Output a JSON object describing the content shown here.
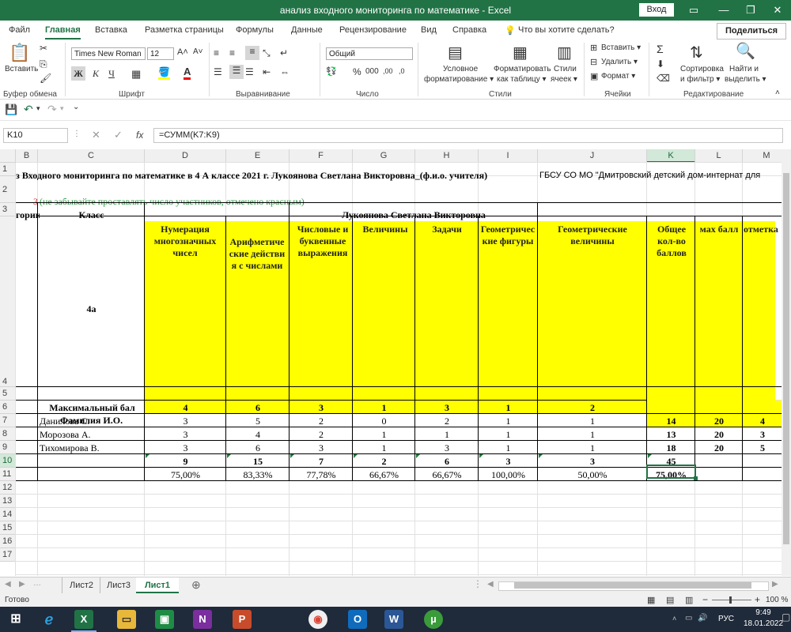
{
  "window": {
    "title": "анализ входного мониторинга по математике - Excel",
    "login": "Вход"
  },
  "tabs": [
    "Файл",
    "Главная",
    "Вставка",
    "Разметка страницы",
    "Формулы",
    "Данные",
    "Рецензирование",
    "Вид",
    "Справка"
  ],
  "tell_me": "Что вы хотите сделать?",
  "share": "Поделиться",
  "ribbon": {
    "paste": "Вставить",
    "font_name": "Times New Roman",
    "font_size": "12",
    "number_format": "Общий",
    "bold": "Ж",
    "italic": "К",
    "underline": "Ч",
    "cond_format": [
      "Условное",
      "форматирование ▾"
    ],
    "format_table": [
      "Форматировать",
      "как таблицу ▾"
    ],
    "cell_styles": [
      "Стили",
      "ячеек ▾"
    ],
    "insert": "Вставить ▾",
    "delete": "Удалить ▾",
    "format": "Формат ▾",
    "sort": [
      "Сортировка",
      "и фильтр ▾"
    ],
    "find": [
      "Найти и",
      "выделить ▾"
    ],
    "groups": [
      "Буфер обмена",
      "Шрифт",
      "Выравнивание",
      "Число",
      "Стили",
      "Ячейки",
      "Редактирование"
    ]
  },
  "formula_bar": {
    "name_box": "K10",
    "formula": "=СУММ(K7:K9)",
    "fx": "fx"
  },
  "columns": [
    "B",
    "C",
    "D",
    "E",
    "F",
    "G",
    "H",
    "I",
    "J",
    "K",
    "L",
    "M"
  ],
  "rows": [
    "1",
    "2",
    "3",
    "4",
    "5",
    "6",
    "7",
    "8",
    "9",
    "10",
    "11",
    "12",
    "13",
    "14",
    "15",
    "16",
    "17"
  ],
  "sheet": {
    "title": "з Входного мониторинга по математике в 4 А классе 2021 г. Лукоянова Светлана Викторовна_(ф.и.о. учителя)",
    "school": "ГБСУ СО МО \"Дмитровский детский дом-интернат для",
    "count": "3",
    "reminder": "(не забывайте проставлять число участников, отмечено красным)",
    "category": "гории",
    "class_label": "Класс",
    "teacher": "Лукоянова Светлана Викторовна",
    "class_value": "4а",
    "headers": [
      "Нумерация многозначных чисел",
      "Арифметические действия с числами",
      "Числовые и буквенные выражения",
      "Величины",
      "Задачи",
      "Геометрические фигуры",
      "Геометрические величины",
      "Общее кол-во баллов",
      "мах балл",
      "отметка"
    ],
    "max_label": "Максимальный бал",
    "max_values": [
      "4",
      "6",
      "3",
      "1",
      "3",
      "1",
      "2"
    ],
    "fio_label": "Фамилия И.О.",
    "students": [
      {
        "name": "Данилова С.",
        "scores": [
          "3",
          "5",
          "2",
          "0",
          "2",
          "1",
          "1"
        ],
        "total": "14",
        "max": "20",
        "mark": "4"
      },
      {
        "name": "Морозова А.",
        "scores": [
          "3",
          "4",
          "2",
          "1",
          "1",
          "1",
          "1"
        ],
        "total": "13",
        "max": "20",
        "mark": "3"
      },
      {
        "name": "Тихомирова В.",
        "scores": [
          "3",
          "6",
          "3",
          "1",
          "3",
          "1",
          "1"
        ],
        "total": "18",
        "max": "20",
        "mark": "5"
      }
    ],
    "sums": [
      "9",
      "15",
      "7",
      "2",
      "6",
      "3",
      "3",
      "45"
    ],
    "percents": [
      "75,00%",
      "83,33%",
      "77,78%",
      "66,67%",
      "66,67%",
      "100,00%",
      "50,00%",
      "75,00%"
    ]
  },
  "sheet_tabs": [
    "Лист2",
    "Лист3",
    "Лист1"
  ],
  "active_sheet": "Лист1",
  "status": {
    "ready": "Готово",
    "zoom": "100 %"
  },
  "taskbar": {
    "time": "9:49",
    "date": "18.01.2022",
    "lang": "РУС"
  },
  "colors": {
    "excel_green": "#217346",
    "highlight": "#ffff00",
    "reminder_green": "#2e9b46",
    "count_red": "#d62b2b"
  }
}
